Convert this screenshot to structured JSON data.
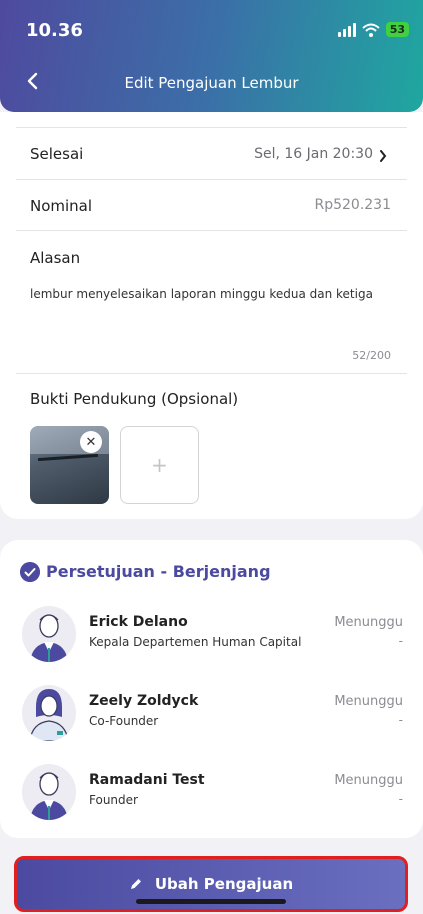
{
  "status_bar": {
    "time": "10.36",
    "battery": "53"
  },
  "header": {
    "title": "Edit  Pengajuan Lembur"
  },
  "form": {
    "selesai_label": "Selesai",
    "selesai_value": "Sel, 16 Jan 20:30",
    "nominal_label": "Nominal",
    "nominal_value": "Rp520.231",
    "alasan_label": "Alasan",
    "alasan_value": "lembur menyelesaikan laporan minggu kedua dan ketiga",
    "alasan_count": "52/200",
    "bukti_label": "Bukti Pendukung (Opsional)",
    "add_symbol": "+",
    "remove_symbol": "✕"
  },
  "approval": {
    "title": "Persetujuan - Berjenjang",
    "approvers": [
      {
        "name": "Erick Delano",
        "role": "Kepala Departemen Human Capital",
        "status": "Menunggu",
        "date": "-"
      },
      {
        "name": "Zeely Zoldyck",
        "role": "Co-Founder",
        "status": "Menunggu",
        "date": "-"
      },
      {
        "name": "Ramadani Test",
        "role": "Founder",
        "status": "Menunggu",
        "date": "-"
      }
    ]
  },
  "submit": {
    "label": "Ubah Pengajuan"
  }
}
